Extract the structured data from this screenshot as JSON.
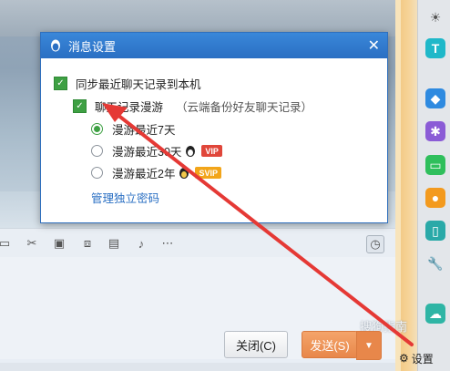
{
  "dialog": {
    "title": "消息设置",
    "close_icon": "close-icon",
    "sync_label": "同步最近聊天记录到本机",
    "roam_label": "聊天记录漫游",
    "roam_hint": "（云端备份好友聊天记录）",
    "options": [
      {
        "label": "漫游最近7天",
        "selected": true,
        "badge": ""
      },
      {
        "label": "漫游最近30天",
        "selected": false,
        "badge": "VIP"
      },
      {
        "label": "漫游最近2年",
        "selected": false,
        "badge": "SVIP"
      }
    ],
    "password_link": "管理独立密码"
  },
  "footer": {
    "close_button": "关闭(C)",
    "send_button": "发送(S)",
    "settings_label": "设置"
  },
  "watermark": "搜狗指南",
  "colors": {
    "accent": "#2a6fc3",
    "check": "#3ea043",
    "send": "#e8874a",
    "annotation": "#e53935"
  }
}
